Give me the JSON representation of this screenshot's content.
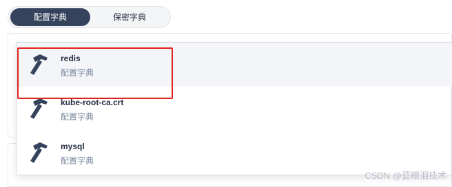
{
  "tabs": {
    "active_label": "配置字典",
    "inactive_label": "保密字典"
  },
  "dropdown": {
    "items": [
      {
        "name": "redis",
        "type": "配置字典",
        "icon": "hammer-icon"
      },
      {
        "name": "kube-root-ca.crt",
        "type": "配置字典",
        "icon": "hammer-icon"
      },
      {
        "name": "mysql",
        "type": "配置字典",
        "icon": "hammer-icon"
      }
    ]
  },
  "watermark": "CSDN @蓝眼泪技术",
  "colors": {
    "active_tab": "#36435c",
    "highlight": "#e0231c",
    "name_text": "#242e42",
    "desc_text": "#79879c"
  }
}
